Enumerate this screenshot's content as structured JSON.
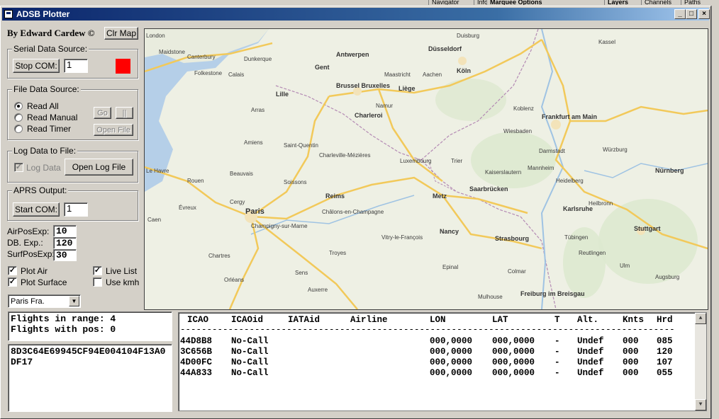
{
  "background_app": {
    "tabs": [
      "Navigator",
      "Info",
      "Marquee Options",
      "Layers",
      "Channels",
      "Paths"
    ]
  },
  "window": {
    "title": "ADSB Plotter",
    "icon": "app-icon",
    "minimize": "_",
    "maximize": "□",
    "close": "×"
  },
  "header": {
    "author": "By Edward Cardew ©",
    "clear_map_label": "Clr Map"
  },
  "serial": {
    "group_label": "Serial Data Source:",
    "button_label": "Stop COM:",
    "port_value": "1",
    "status_color": "#ff0000"
  },
  "file_source": {
    "group_label": "File Data Source:",
    "options": [
      "Read All",
      "Read Manual",
      "Read Timer"
    ],
    "selected": "Read All",
    "go_label": "Go",
    "pause_label": "||",
    "open_file_label": "Open File"
  },
  "log": {
    "group_label": "Log Data to File:",
    "checkbox_label": "Log Data",
    "checked": true,
    "open_log_label": "Open Log File"
  },
  "aprs": {
    "group_label": "APRS Output:",
    "button_label": "Start COM:",
    "port_value": "1"
  },
  "expiry": {
    "air_label": "AirPosExp:",
    "air_value": "10",
    "db_label": "DB. Exp.:",
    "db_value": "120",
    "surf_label": "SurfPosExp:",
    "surf_value": "30"
  },
  "options": {
    "plot_air": {
      "label": "Plot Air",
      "checked": true
    },
    "plot_surface": {
      "label": "Plot Surface",
      "checked": true
    },
    "live_list": {
      "label": "Live List",
      "checked": true
    },
    "use_kmh": {
      "label": "Use kmh",
      "checked": false
    }
  },
  "location": {
    "selected": "Paris Fra."
  },
  "status": {
    "line1": "Flights in range: 4",
    "line2": "Flights with pos: 0"
  },
  "raw_message": "8D3C64E69945CF94E004104F13A0DF17",
  "flights": {
    "headers": [
      "ICAO",
      "ICAOid",
      "IATAid",
      "Airline",
      "LON",
      "LAT",
      "T",
      "Alt.",
      "Knts",
      "Hrd"
    ],
    "separator": "--------------------------------------------------------------------------------------------------",
    "rows": [
      [
        "44D8B8",
        "No-Call",
        "",
        "",
        "000,0000",
        "000,0000",
        "-",
        "Undef",
        "000",
        "085"
      ],
      [
        "3C656B",
        "No-Call",
        "",
        "",
        "000,0000",
        "000,0000",
        "-",
        "Undef",
        "000",
        "120"
      ],
      [
        "4D00FC",
        "No-Call",
        "",
        "",
        "000,0000",
        "000,0000",
        "-",
        "Undef",
        "000",
        "107"
      ],
      [
        "44A833",
        "No-Call",
        "",
        "",
        "000,0000",
        "000,0000",
        "-",
        "Undef",
        "000",
        "055"
      ]
    ]
  },
  "map": {
    "cities": [
      "London",
      "Maidstone",
      "Canterbury",
      "Folkestone",
      "Dunkerque",
      "Calais",
      "Lille",
      "Gent",
      "Antwerpen",
      "Brussel Bruxelles",
      "Liège",
      "Maastricht",
      "Aachen",
      "Köln",
      "Düsseldorf",
      "Duisburg",
      "Amiens",
      "Saint-Quentin",
      "Charleroi",
      "Namur",
      "Koblenz",
      "Frankfurt am Main",
      "Wiesbaden",
      "Darmstadt",
      "Mannheim",
      "Heidelberg",
      "Luxembourg",
      "Trier",
      "Kaiserslautern",
      "Saarbrücken",
      "Metz",
      "Reims",
      "Paris",
      "Beauvais",
      "Rouen",
      "Caen",
      "Chartres",
      "Orléans",
      "Troyes",
      "Nancy",
      "Strasbourg",
      "Karlsruhe",
      "Stuttgart",
      "Freiburg im Breisgau",
      "Würzburg",
      "Nürnberg",
      "Augsburg",
      "Ulm",
      "Reutlingen",
      "Tübingen",
      "Heilbronn",
      "Kassel",
      "Le Havre",
      "Évreux",
      "Châlons-en-Champagne",
      "Charleville-Mézières",
      "Champigny-sur-Marne",
      "Vitry-le-François",
      "Epinal",
      "Mulhouse",
      "Colmar",
      "Auxerre",
      "Sens",
      "Cergy",
      "Arras",
      "Soissons"
    ]
  }
}
